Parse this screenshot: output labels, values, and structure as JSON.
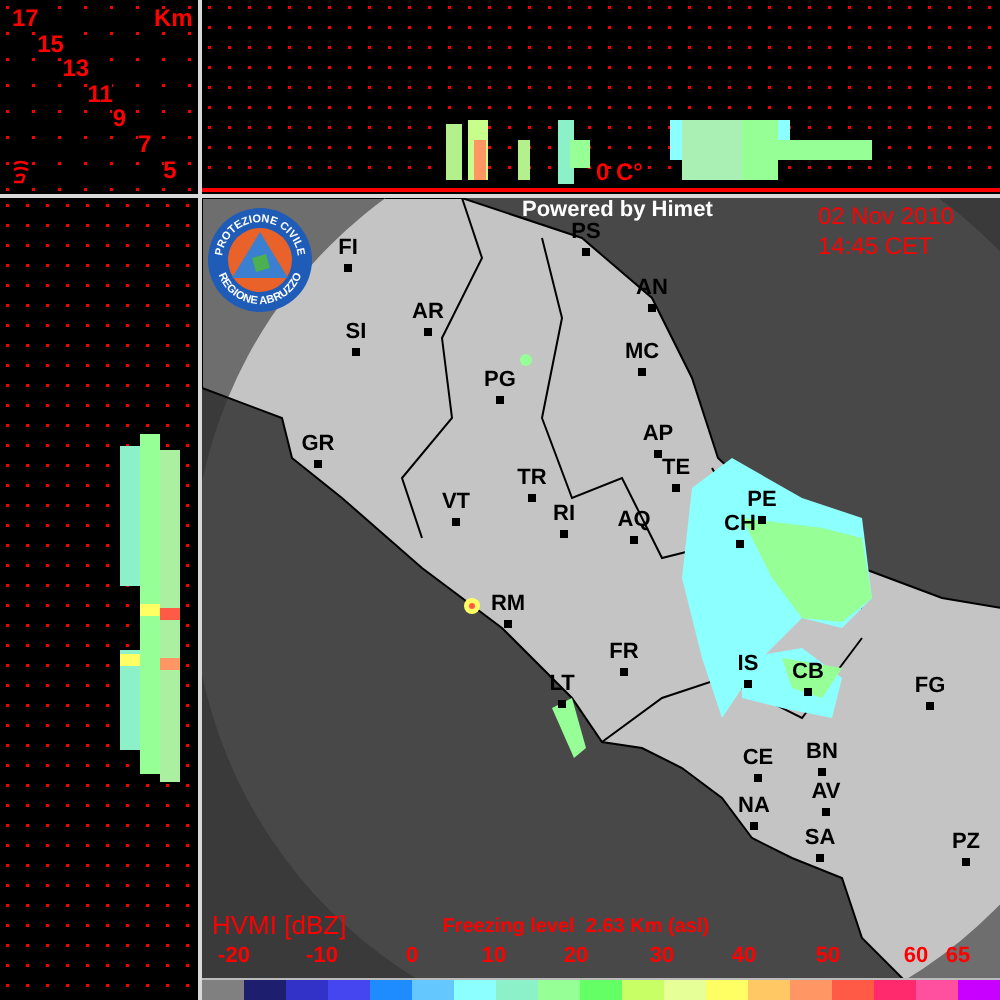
{
  "altitude_axis": {
    "unit": "Km",
    "labels": [
      "17",
      "15",
      "13",
      "11",
      "9",
      "7",
      "5"
    ]
  },
  "vertical_section": {
    "isotherm_label": "0 C°"
  },
  "map": {
    "credit": "Powered by Himet",
    "date": "02 Nov 2010",
    "time": "14:45 CET",
    "logo": {
      "top_text": "PROTEZIONE CIVILE",
      "bottom_text": "REGIONE ABRUZZO"
    },
    "cities": [
      {
        "label": "PS"
      },
      {
        "label": "FI"
      },
      {
        "label": "AN"
      },
      {
        "label": "SI"
      },
      {
        "label": "AR"
      },
      {
        "label": "MC"
      },
      {
        "label": "PG"
      },
      {
        "label": "AP"
      },
      {
        "label": "GR"
      },
      {
        "label": "TE"
      },
      {
        "label": "TR"
      },
      {
        "label": "VT"
      },
      {
        "label": "RI"
      },
      {
        "label": "PE"
      },
      {
        "label": "AQ"
      },
      {
        "label": "CH"
      },
      {
        "label": "RM"
      },
      {
        "label": "FR"
      },
      {
        "label": "IS"
      },
      {
        "label": "CB"
      },
      {
        "label": "LT"
      },
      {
        "label": "FG"
      },
      {
        "label": "CE"
      },
      {
        "label": "BN"
      },
      {
        "label": "AV"
      },
      {
        "label": "NA"
      },
      {
        "label": "SA"
      },
      {
        "label": "PZ"
      }
    ]
  },
  "legend": {
    "product": "HVMI [dBZ]",
    "freezing_level": "Freezing level  2.63 Km (asl)",
    "ticks": [
      "-20",
      "-10",
      "0",
      "10",
      "20",
      "30",
      "40",
      "50",
      "60",
      "65"
    ],
    "swatches": [
      {
        "color": "#808080"
      },
      {
        "color": "#1e1e6e"
      },
      {
        "color": "#3232c8"
      },
      {
        "color": "#4646f0"
      },
      {
        "color": "#1e8cff"
      },
      {
        "color": "#64c8ff"
      },
      {
        "color": "#8cffff"
      },
      {
        "color": "#8cf0c8"
      },
      {
        "color": "#96ff96"
      },
      {
        "color": "#64ff64"
      },
      {
        "color": "#c8ff64"
      },
      {
        "color": "#e6ff96"
      },
      {
        "color": "#ffff64"
      },
      {
        "color": "#ffc864"
      },
      {
        "color": "#ff9664"
      },
      {
        "color": "#ff5a46"
      },
      {
        "color": "#ff2a6e"
      },
      {
        "color": "#ff50a0"
      },
      {
        "color": "#c800ff"
      }
    ]
  }
}
